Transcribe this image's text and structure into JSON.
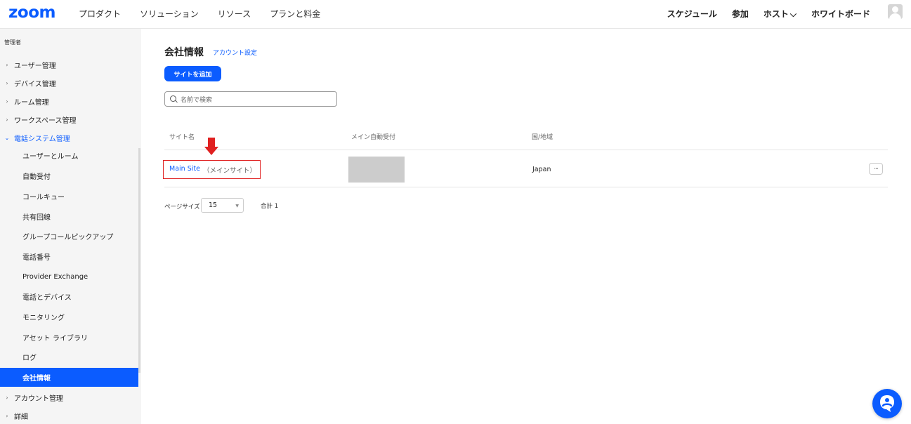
{
  "brand": {
    "logo": "zoom",
    "accent": "#0b5cff",
    "highlight": "#e02020"
  },
  "topnav": {
    "left": [
      "プロダクト",
      "ソリューション",
      "リソース",
      "プランと料金"
    ],
    "right": {
      "schedule": "スケジュール",
      "join": "参加",
      "host": "ホスト",
      "whiteboard": "ホワイトボード"
    }
  },
  "sidebar": {
    "heading": "管理者",
    "items": {
      "user_mgmt": "ユーザー管理",
      "device_mgmt": "デバイス管理",
      "room_mgmt": "ルーム管理",
      "workspace_mgmt": "ワークスペース管理",
      "phone_system": "電話システム管理",
      "account_mgmt": "アカウント管理",
      "details": "詳細"
    },
    "sub": [
      "ユーザーとルーム",
      "自動受付",
      "コールキュー",
      "共有回線",
      "グループコールピックアップ",
      "電話番号",
      "Provider Exchange",
      "電話とデバイス",
      "モニタリング",
      "アセット ライブラリ",
      "ログ",
      "会社情報"
    ],
    "active_sub": "会社情報"
  },
  "main": {
    "title": "会社情報",
    "link": "アカウント設定",
    "add_button": "サイトを追加",
    "search_placeholder": "名前で検索",
    "columns": {
      "site": "サイト名",
      "auto_receptionist": "メイン自動受付",
      "country": "国/地域"
    },
    "rows": [
      {
        "site_name": "Main Site",
        "site_tag": "（メインサイト）",
        "country": "Japan",
        "more": "···"
      }
    ],
    "pagination": {
      "label": "ページサイズ",
      "size": "15",
      "total": "合計 1"
    }
  }
}
